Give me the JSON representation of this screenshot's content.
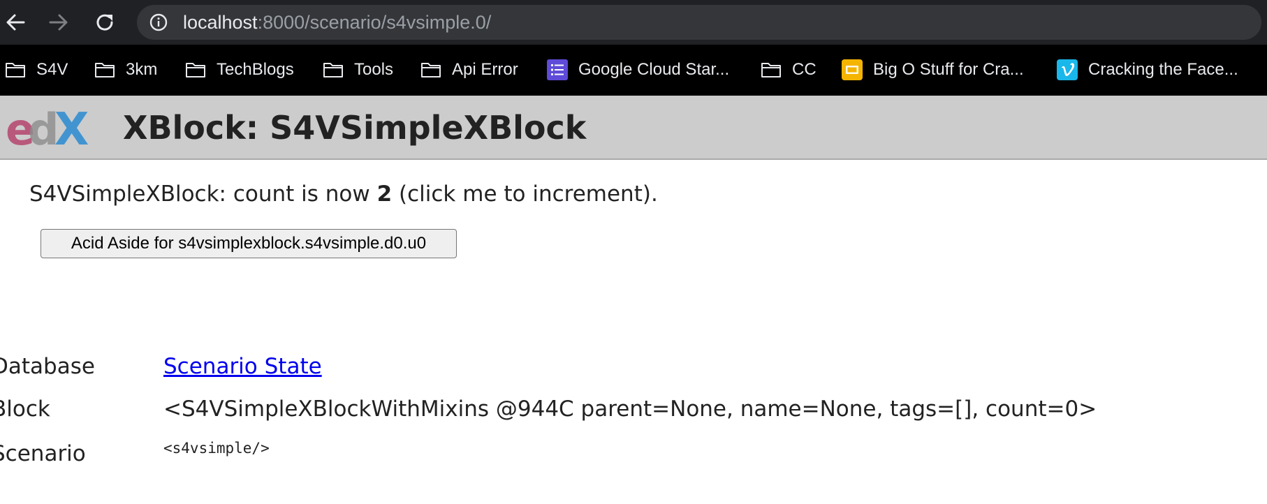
{
  "browser": {
    "url_host": "localhost",
    "url_rest": ":8000/scenario/s4vsimple.0/",
    "nav": {
      "back_icon": "arrow-left-icon",
      "forward_icon": "arrow-right-icon",
      "reload_icon": "reload-icon",
      "info_icon": "info-circle-icon"
    },
    "bookmarks": [
      {
        "label": "S4V",
        "icon": "folder-icon"
      },
      {
        "label": "3km",
        "icon": "folder-icon"
      },
      {
        "label": "TechBlogs",
        "icon": "folder-icon"
      },
      {
        "label": "Tools",
        "icon": "folder-icon"
      },
      {
        "label": "Api Error",
        "icon": "folder-icon"
      },
      {
        "label": "Google Cloud Star...",
        "icon": "google-forms-icon"
      },
      {
        "label": "CC",
        "icon": "folder-icon"
      },
      {
        "label": "Big O Stuff for Cra...",
        "icon": "google-slides-icon"
      },
      {
        "label": "Cracking the Face...",
        "icon": "vimeo-icon"
      }
    ],
    "colors": {
      "toolbar_bg": "#202124",
      "bookmarks_bg": "#000000",
      "forms_purple": "#5e4bd8",
      "slides_yellow": "#f4b400",
      "vimeo_blue": "#1ab7ea"
    }
  },
  "header": {
    "logo": "edx-logo",
    "title": "XBlock: S4VSimpleXBlock"
  },
  "content": {
    "count_prefix": "S4VSimpleXBlock: count is now ",
    "count_value": "2",
    "count_suffix": " (click me to increment).",
    "acid_button_label": "Acid Aside for s4vsimplexblock.s4vsimple.d0.u0"
  },
  "info": {
    "database_label": "Database",
    "database_link": "Scenario State",
    "block_label": "Block",
    "block_value": "<S4VSimpleXBlockWithMixins @944C parent=None, name=None, tags=[], count=0>",
    "scenario_label": "Scenario",
    "scenario_value": "<s4vsimple/>"
  },
  "link_color": "#0000ee"
}
